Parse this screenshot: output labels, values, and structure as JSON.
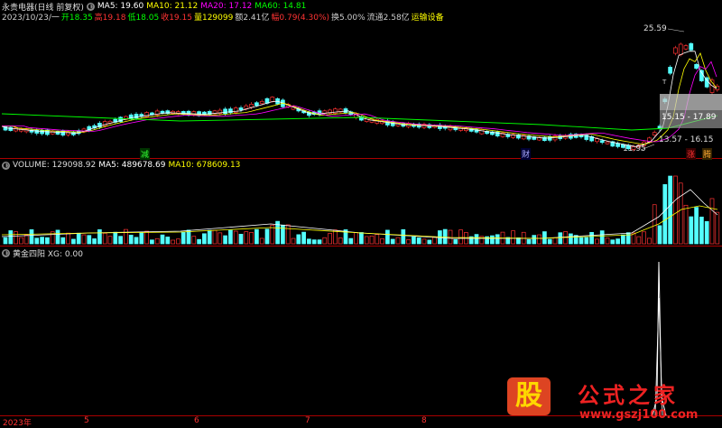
{
  "header": {
    "title": "永贵电器(日线 前复权)",
    "ma5": "MA5: 19.60",
    "ma10": "MA10: 21.12",
    "ma20": "MA20: 17.12",
    "ma60": "MA60: 14.81",
    "date": "2023/10/23/一",
    "open": "开18.35",
    "high": "高19.18",
    "low": "低18.05",
    "close": "收19.15",
    "vol": "量129099",
    "amount": "额2.41亿",
    "change": "幅0.79(4.30%)",
    "turnover": "换5.00%",
    "float": "流通2.58亿",
    "industry": "运输设备"
  },
  "price_labels": {
    "high": "25.59",
    "low": "11.95",
    "range1": "15.15 - 17.89",
    "range2": "13.57 - 16.15",
    "t_mark": "T",
    "jian": "减",
    "cai": "财",
    "zhang": "涨",
    "teng": "腾"
  },
  "volume_panel": {
    "label": "VOLUME: 129098.92",
    "ma5": "MA5: 489678.69",
    "ma10": "MA10: 678609.13"
  },
  "indicator_panel": {
    "label": "黄金四阳 XG: 0.00"
  },
  "xaxis": {
    "year": "2023年",
    "m5": "5",
    "m6": "6",
    "m7": "7",
    "m8": "8"
  },
  "logo": {
    "gu": "股",
    "brand": "公式之家",
    "url": "www.gszj100.com"
  },
  "colors": {
    "up": "#ff3232",
    "down": "#54ffff",
    "ma5": "#ffffff",
    "ma10": "#ffff00",
    "ma20": "#ff00ff",
    "ma60": "#00ff00"
  }
}
